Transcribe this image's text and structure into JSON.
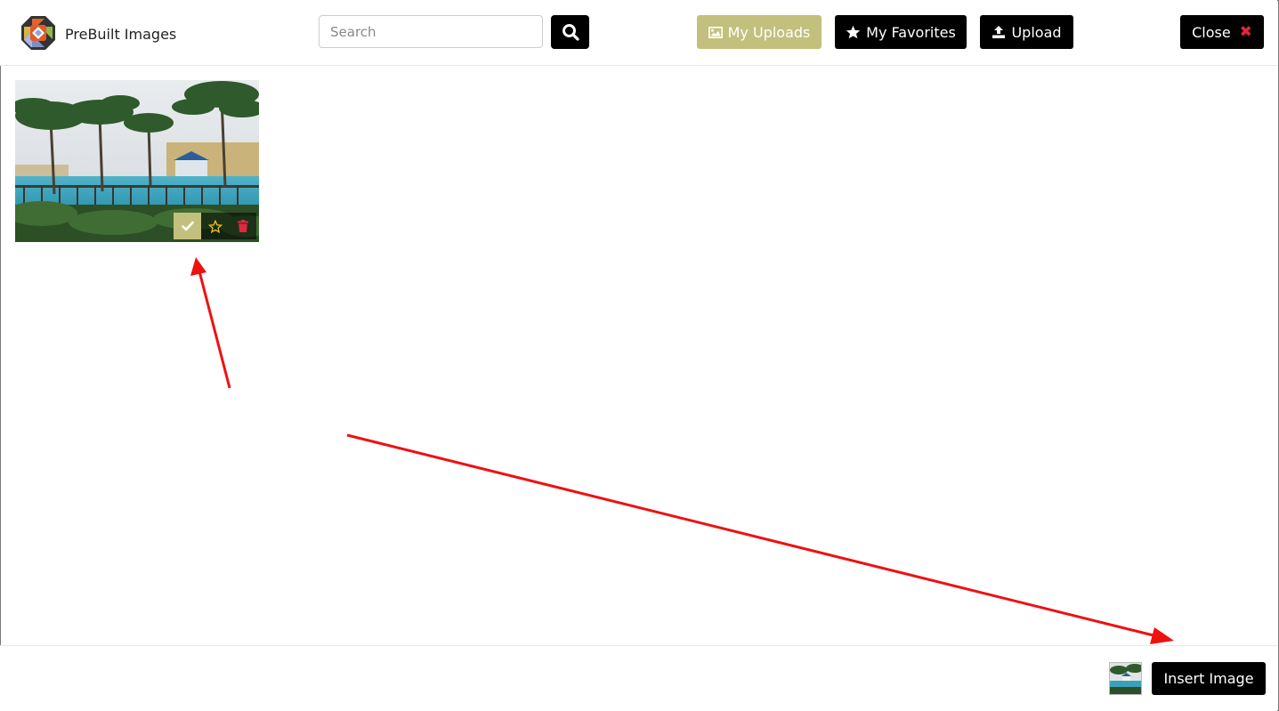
{
  "header": {
    "brand": "PreBuilt Images",
    "search": {
      "placeholder": "Search",
      "value": ""
    },
    "buttons": {
      "my_uploads": "My Uploads",
      "my_favorites": "My Favorites",
      "upload": "Upload",
      "close": "Close"
    }
  },
  "gallery": {
    "items": [
      {
        "alt": "palm trees pool",
        "selected": true,
        "favorite": false
      }
    ]
  },
  "footer": {
    "insert_label": "Insert Image"
  },
  "colors": {
    "accent": "#c3c07e",
    "dark": "#000000",
    "danger": "#e2263d",
    "star": "#f0c419",
    "annotation": "#ee1111"
  },
  "icons": [
    "logo-icon",
    "search-icon",
    "image-icon",
    "star-icon",
    "upload-icon",
    "close-icon",
    "check-icon",
    "star-outline-icon",
    "trash-icon"
  ]
}
